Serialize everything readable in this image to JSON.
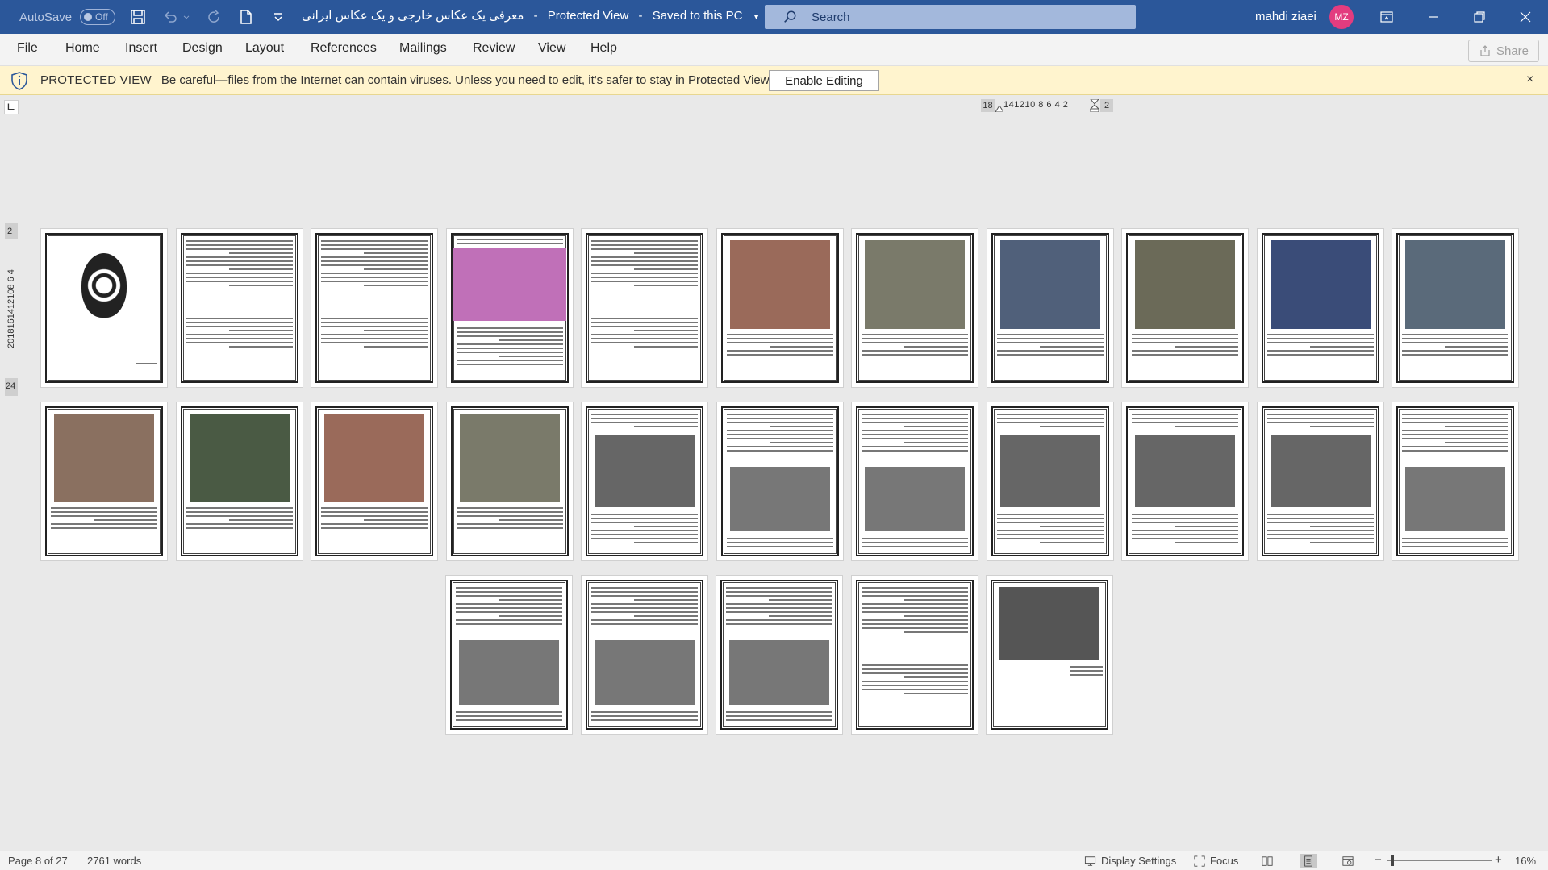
{
  "titlebar": {
    "autosave_label": "AutoSave",
    "autosave_state": "Off",
    "document_title": "معرفی یک عکاس خارجی و یک عکاس ایرانی",
    "separator": "-",
    "mode": "Protected View",
    "separator2": "-",
    "save_status": "Saved to this PC",
    "search_placeholder": "Search",
    "user_name": "mahdi ziaei",
    "user_initials": "MZ"
  },
  "menu": {
    "items": [
      "File",
      "Home",
      "Insert",
      "Design",
      "Layout",
      "References",
      "Mailings",
      "Review",
      "View",
      "Help"
    ],
    "share_label": "Share"
  },
  "protected_view": {
    "title": "PROTECTED VIEW",
    "message": "Be careful—files from the Internet can contain viruses. Unless you need to edit, it's safer to stay in Protected View.",
    "enable_button": "Enable Editing",
    "close": "×"
  },
  "ruler": {
    "h_left": "18",
    "h_numbers": "141210 8  6  4  2",
    "h_right": "2",
    "v_top": "2",
    "v_numbers": "2018161412108 6 4",
    "v_bottom": "24"
  },
  "pages": {
    "total": 27,
    "shown_rows": [
      11,
      11,
      5
    ]
  },
  "status": {
    "page": "Page 8 of 27",
    "words": "2761 words",
    "display_settings": "Display Settings",
    "focus": "Focus",
    "zoom_minus": "−",
    "zoom_plus": "+",
    "zoom_level": "16%"
  },
  "colors": {
    "titlebar": "#2b579a",
    "protected_bar": "#fff4ce",
    "avatar": "#e33c7f"
  }
}
